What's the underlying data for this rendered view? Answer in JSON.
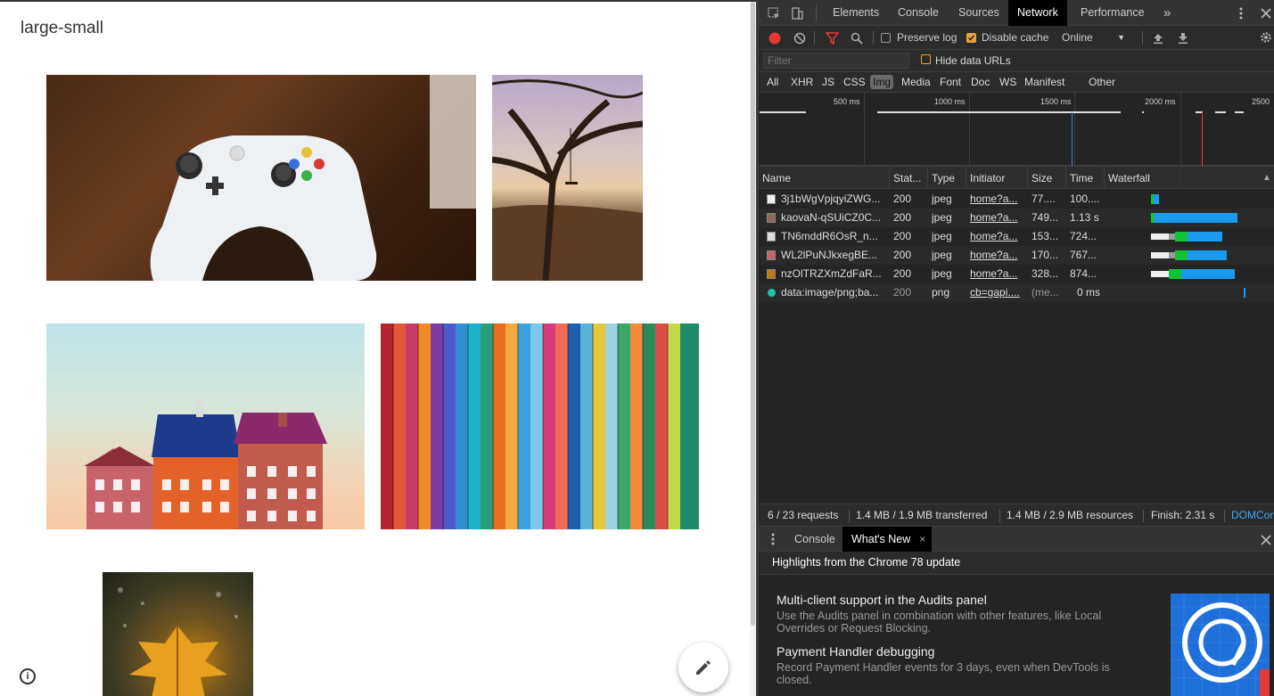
{
  "page": {
    "title": "large-small"
  },
  "devtools": {
    "tabs": [
      "Elements",
      "Console",
      "Sources",
      "Network",
      "Performance"
    ],
    "active_tab": "Network",
    "more_tabs_icon": "»",
    "toolbar": {
      "preserve_log": "Preserve log",
      "preserve_log_checked": false,
      "disable_cache": "Disable cache",
      "disable_cache_checked": true,
      "throttling": "Online"
    },
    "filter": {
      "placeholder": "Filter",
      "hide_data_urls": "Hide data URLs"
    },
    "types": [
      "All",
      "XHR",
      "JS",
      "CSS",
      "Img",
      "Media",
      "Font",
      "Doc",
      "WS",
      "Manifest",
      "Other"
    ],
    "active_type": "Img",
    "overview_labels": [
      "500 ms",
      "1000 ms",
      "1500 ms",
      "2000 ms",
      "2500"
    ],
    "columns": [
      "Name",
      "Stat...",
      "Type",
      "Initiator",
      "Size",
      "Time",
      "Waterfall"
    ],
    "requests": [
      {
        "name": "3j1bWgVpjqyiZWG...",
        "status": "200",
        "type": "jpeg",
        "initiator": "home?a...",
        "size": "77....",
        "time": "100...."
      },
      {
        "name": "kaovaN-qSUiCZ0C...",
        "status": "200",
        "type": "jpeg",
        "initiator": "home?a...",
        "size": "749...",
        "time": "1.13 s"
      },
      {
        "name": "TN6mddR6OsR_n...",
        "status": "200",
        "type": "jpeg",
        "initiator": "home?a...",
        "size": "153...",
        "time": "724..."
      },
      {
        "name": "WL2lPuNJkxegBE...",
        "status": "200",
        "type": "jpeg",
        "initiator": "home?a...",
        "size": "170...",
        "time": "767..."
      },
      {
        "name": "nzOlTRZXmZdFaR...",
        "status": "200",
        "type": "jpeg",
        "initiator": "home?a...",
        "size": "328...",
        "time": "874..."
      },
      {
        "name": "data:image/png;ba...",
        "status": "200",
        "type": "png",
        "initiator": "cb=gapi....",
        "size": "(me...",
        "time": "0 ms"
      }
    ],
    "status_bar": {
      "requests": "6 / 23 requests",
      "transferred": "1.4 MB / 1.9 MB transferred",
      "resources": "1.4 MB / 2.9 MB resources",
      "finish": "Finish: 2.31 s",
      "domcontent": "DOMCon"
    },
    "drawer": {
      "tabs": [
        "Console",
        "What's New"
      ],
      "active_tab": "What's New",
      "heading": "Highlights from the Chrome 78 update",
      "items": [
        {
          "title": "Multi-client support in the Audits panel",
          "desc": "Use the Audits panel in combination with other features, like Local Overrides or Request Blocking."
        },
        {
          "title": "Payment Handler debugging",
          "desc": "Record Payment Handler events for 3 days, even when DevTools is closed."
        }
      ]
    }
  },
  "colors": {
    "record": "#e53935",
    "filter_active": "#e8a33a",
    "waterfall_blue": "#1a9bef",
    "waterfall_green": "#12c33a",
    "domcontent_line": "#3b7de8",
    "load_line": "#e53935",
    "link": "#3ba7f0"
  }
}
